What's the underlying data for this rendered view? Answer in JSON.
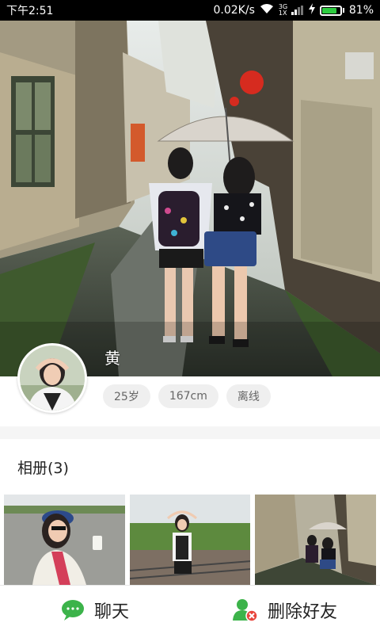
{
  "status_bar": {
    "time": "下午2:51",
    "net_speed": "0.02K/s",
    "signal": "3G 1X",
    "battery_percent": "81%",
    "battery_level": 0.81
  },
  "profile": {
    "name": "黄",
    "tags": [
      "25岁",
      "167cm",
      "离线"
    ]
  },
  "album": {
    "title": "相册(3)",
    "photos": [
      "photo-1",
      "photo-2",
      "photo-3"
    ]
  },
  "actions": {
    "chat_label": "聊天",
    "delete_label": "删除好友"
  },
  "colors": {
    "accent_green": "#3cb34a",
    "delete_red": "#e8453c"
  }
}
